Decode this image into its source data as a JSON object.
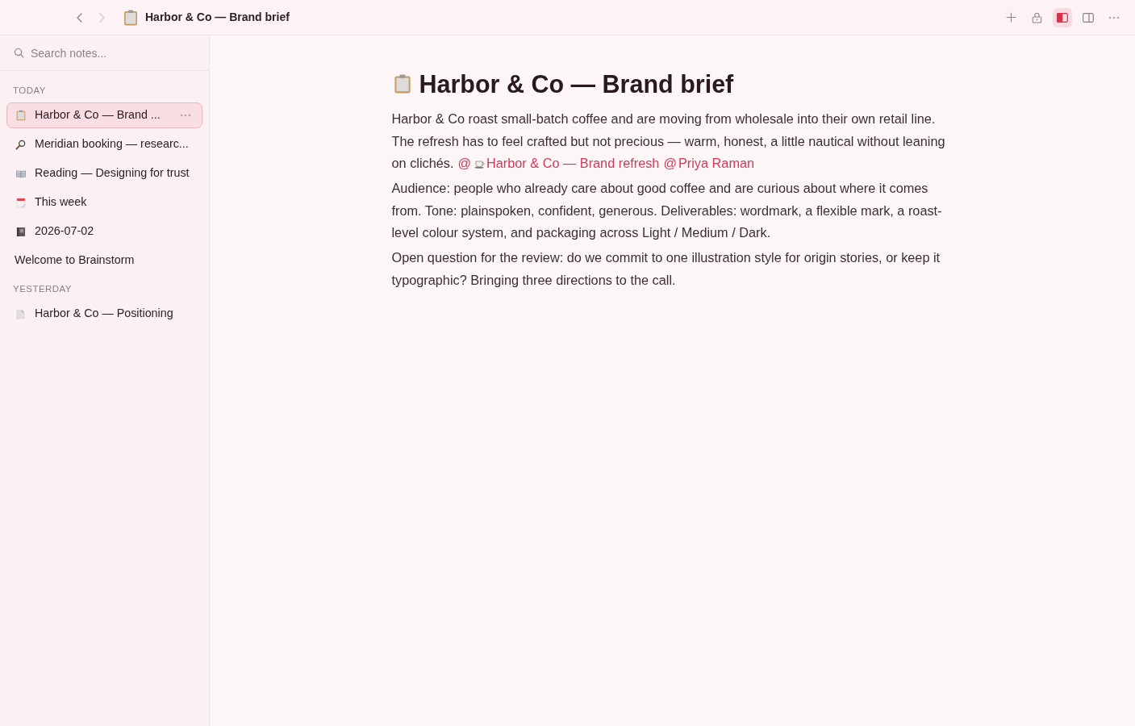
{
  "titlebar": {
    "back": {
      "disabled": false
    },
    "forward": {
      "disabled": true
    },
    "title": "Harbor & Co — Brand brief",
    "actions": [
      {
        "selected": false
      },
      {
        "selected": false
      },
      {
        "selected": true
      },
      {
        "selected": false
      },
      {
        "selected": false
      }
    ]
  },
  "sidebar": {
    "search": {
      "placeholder": "Search notes..."
    },
    "sections": [
      {
        "heading": "TODAY",
        "items": [
          {
            "kind": "emoji",
            "label": "Harbor & Co — Brand ...",
            "selected": true
          },
          {
            "kind": "emoji",
            "label": "Meridian booking — researc...",
            "selected": false
          },
          {
            "kind": "emoji",
            "label": "Reading — Designing for trust",
            "selected": false
          },
          {
            "kind": "emoji",
            "label": "This week",
            "selected": false
          },
          {
            "kind": "emoji",
            "label": "2026-07-02",
            "selected": false
          },
          {
            "kind": "plain",
            "label": "Welcome to Brainstorm",
            "selected": false
          }
        ]
      },
      {
        "heading": "YESTERDAY",
        "items": [
          {
            "kind": "emoji",
            "label": "Harbor & Co — Positioning",
            "selected": false
          }
        ]
      }
    ]
  },
  "note": {
    "title": "Harbor & Co — Brand brief",
    "paragraphs": [
      [
        {
          "kind": "text",
          "text": "Harbor & Co roast small-batch coffee and are moving from wholesale into their own retail line. The refresh has to feel crafted but not precious — warm, honest, a little nautical without leaning on clichés."
        },
        {
          "kind": "page",
          "at": "@",
          "label": "Harbor & Co — Brand refresh"
        },
        {
          "kind": "person",
          "at": "@",
          "label": "Priya Raman"
        }
      ],
      [
        {
          "kind": "text",
          "text": "Audience: people who already care about good coffee and are curious about where it comes from. Tone: plainspoken, confident, generous. Deliverables: wordmark, a flexible mark, a roast-level colour system, and packaging across Light / Medium / Dark."
        }
      ],
      [
        {
          "kind": "text",
          "text": "Open question for the review: do we commit to one illustration style for origin stories, or keep it typographic? Bringing three directions to the call."
        }
      ]
    ]
  }
}
